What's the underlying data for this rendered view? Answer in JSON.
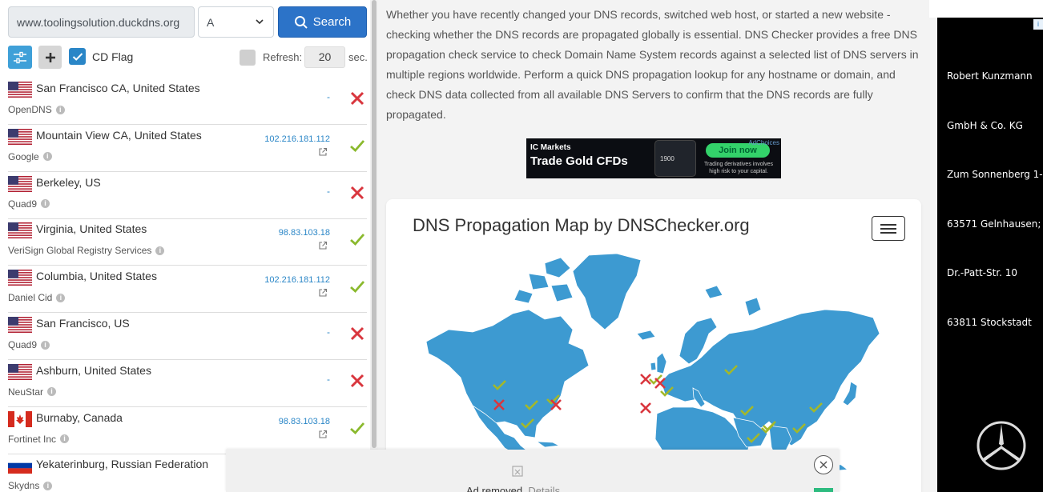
{
  "search": {
    "domain": "www.toolingsolution.duckdns.org",
    "record_type": "A",
    "button_label": "Search"
  },
  "options": {
    "cd_flag_label": "CD Flag",
    "cd_flag_checked": true,
    "refresh_label": "Refresh:",
    "refresh_value": "20",
    "refresh_unit": "sec."
  },
  "servers": [
    {
      "location": "San Francisco CA, United States",
      "provider": "OpenDNS",
      "result": "-",
      "status": "fail",
      "flag": "us"
    },
    {
      "location": "Mountain View CA, United States",
      "provider": "Google",
      "result": "102.216.181.112",
      "status": "ok",
      "flag": "us"
    },
    {
      "location": "Berkeley, US",
      "provider": "Quad9",
      "result": "-",
      "status": "fail",
      "flag": "us"
    },
    {
      "location": "Virginia, United States",
      "provider": "VeriSign Global Registry Services",
      "result": "98.83.103.18",
      "status": "ok",
      "flag": "us"
    },
    {
      "location": "Columbia, United States",
      "provider": "Daniel Cid",
      "result": "102.216.181.112",
      "status": "ok",
      "flag": "us"
    },
    {
      "location": "San Francisco, US",
      "provider": "Quad9",
      "result": "-",
      "status": "fail",
      "flag": "us"
    },
    {
      "location": "Ashburn, United States",
      "provider": "NeuStar",
      "result": "-",
      "status": "fail",
      "flag": "us"
    },
    {
      "location": "Burnaby, Canada",
      "provider": "Fortinet Inc",
      "result": "98.83.103.18",
      "status": "ok",
      "flag": "ca"
    },
    {
      "location": "Yekaterinburg, Russian Federation",
      "provider": "Skydns",
      "result": "",
      "status": "",
      "flag": "ru"
    }
  ],
  "intro_text": "Whether you have recently changed your DNS records, switched web host, or started a new website - checking whether the DNS records are propagated globally is essential. DNS Checker provides a free DNS propagation check service to check Domain Name System records against a selected list of DNS servers in multiple regions worldwide. Perform a quick DNS propagation lookup for any hostname or domain, and check DNS data collected from all available DNS Servers to confirm that the DNS records are fully propagated.",
  "banner_ad": {
    "brand": "IC Markets",
    "headline": "Trade Gold CFDs",
    "price": "1900",
    "cta": "Join now",
    "disclaimer": "Trading derivatives involves high risk to your capital.",
    "adchoices": "AdChoices"
  },
  "map": {
    "title": "DNS Propagation Map by DNSChecker.org",
    "land_color": "#3d9ad1",
    "ok_color": "#a3b82a",
    "fail_color": "#d9363e"
  },
  "ad_removed": {
    "text": "Ad removed.",
    "details": "Details"
  },
  "right_ad": {
    "lines": [
      "Robert Kunzmann",
      "GmbH & Co. KG",
      "Zum Sonnenberg 1-",
      "63571 Gelnhausen;",
      "Dr.-Patt-Str. 10",
      "63811 Stockstadt"
    ]
  },
  "colors": {
    "primary": "#2c73c8",
    "link": "#2a86c7",
    "ok": "#8ab92d",
    "fail": "#d9363e"
  }
}
